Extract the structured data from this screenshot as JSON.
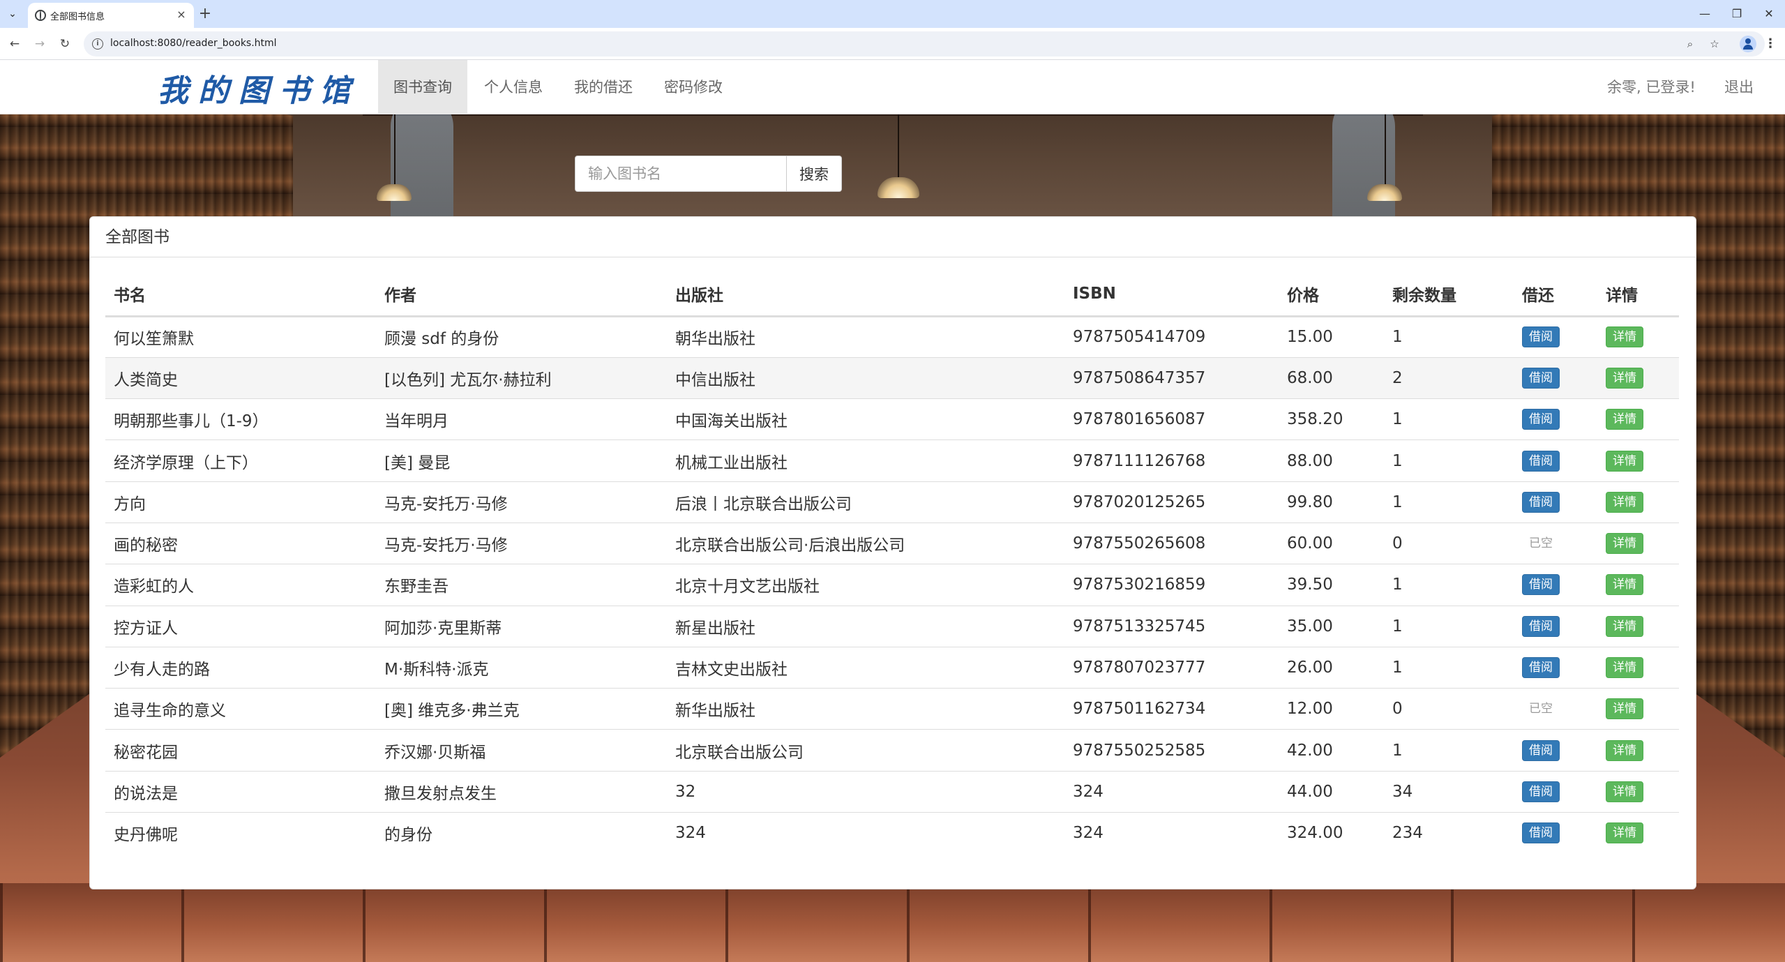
{
  "browser": {
    "tab_title": "全部图书信息",
    "url": "localhost:8080/reader_books.html",
    "tab_close": "×",
    "new_tab": "+",
    "minimize": "—",
    "restore": "❐",
    "close": "✕"
  },
  "navbar": {
    "brand": "我的图书馆",
    "items": [
      {
        "label": "图书查询",
        "active": true
      },
      {
        "label": "个人信息",
        "active": false
      },
      {
        "label": "我的借还",
        "active": false
      },
      {
        "label": "密码修改",
        "active": false
      }
    ],
    "user_status": "余零, 已登录!",
    "logout": "退出"
  },
  "search": {
    "placeholder": "输入图书名",
    "button": "搜索"
  },
  "panel": {
    "title": "全部图书",
    "columns": [
      "书名",
      "作者",
      "出版社",
      "ISBN",
      "价格",
      "剩余数量",
      "借还",
      "详情"
    ],
    "rows": [
      {
        "name": "何以笙箫默",
        "author": "顾漫 sdf 的身份",
        "publisher": "朝华出版社",
        "isbn": "9787505414709",
        "price": "15.00",
        "remaining": "1",
        "borrow": "借阅",
        "borrow_available": true,
        "detail": "详情"
      },
      {
        "name": "人类简史",
        "author": "[以色列] 尤瓦尔·赫拉利",
        "publisher": "中信出版社",
        "isbn": "9787508647357",
        "price": "68.00",
        "remaining": "2",
        "borrow": "借阅",
        "borrow_available": true,
        "detail": "详情"
      },
      {
        "name": "明朝那些事儿（1-9）",
        "author": "当年明月",
        "publisher": "中国海关出版社",
        "isbn": "9787801656087",
        "price": "358.20",
        "remaining": "1",
        "borrow": "借阅",
        "borrow_available": true,
        "detail": "详情"
      },
      {
        "name": "经济学原理（上下）",
        "author": "[美] 曼昆",
        "publisher": "机械工业出版社",
        "isbn": "9787111126768",
        "price": "88.00",
        "remaining": "1",
        "borrow": "借阅",
        "borrow_available": true,
        "detail": "详情"
      },
      {
        "name": "方向",
        "author": "马克-安托万·马修",
        "publisher": "后浪丨北京联合出版公司",
        "isbn": "9787020125265",
        "price": "99.80",
        "remaining": "1",
        "borrow": "借阅",
        "borrow_available": true,
        "detail": "详情"
      },
      {
        "name": "画的秘密",
        "author": "马克-安托万·马修",
        "publisher": "北京联合出版公司·后浪出版公司",
        "isbn": "9787550265608",
        "price": "60.00",
        "remaining": "0",
        "borrow": "已空",
        "borrow_available": false,
        "detail": "详情"
      },
      {
        "name": "造彩虹的人",
        "author": "东野圭吾",
        "publisher": "北京十月文艺出版社",
        "isbn": "9787530216859",
        "price": "39.50",
        "remaining": "1",
        "borrow": "借阅",
        "borrow_available": true,
        "detail": "详情"
      },
      {
        "name": "控方证人",
        "author": "阿加莎·克里斯蒂",
        "publisher": "新星出版社",
        "isbn": "9787513325745",
        "price": "35.00",
        "remaining": "1",
        "borrow": "借阅",
        "borrow_available": true,
        "detail": "详情"
      },
      {
        "name": "少有人走的路",
        "author": "M·斯科特·派克",
        "publisher": "吉林文史出版社",
        "isbn": "9787807023777",
        "price": "26.00",
        "remaining": "1",
        "borrow": "借阅",
        "borrow_available": true,
        "detail": "详情"
      },
      {
        "name": "追寻生命的意义",
        "author": "[奥] 维克多·弗兰克",
        "publisher": "新华出版社",
        "isbn": "9787501162734",
        "price": "12.00",
        "remaining": "0",
        "borrow": "已空",
        "borrow_available": false,
        "detail": "详情"
      },
      {
        "name": "秘密花园",
        "author": "乔汉娜·贝斯福",
        "publisher": "北京联合出版公司",
        "isbn": "9787550252585",
        "price": "42.00",
        "remaining": "1",
        "borrow": "借阅",
        "borrow_available": true,
        "detail": "详情"
      },
      {
        "name": "的说法是",
        "author": "撒旦发射点发生",
        "publisher": "32",
        "isbn": "324",
        "price": "44.00",
        "remaining": "34",
        "borrow": "借阅",
        "borrow_available": true,
        "detail": "详情"
      },
      {
        "name": "史丹佛呢",
        "author": "的身份",
        "publisher": "324",
        "isbn": "324",
        "price": "324.00",
        "remaining": "234",
        "borrow": "借阅",
        "borrow_available": true,
        "detail": "详情"
      }
    ]
  },
  "colors": {
    "brand": "#1f5aa6",
    "primary_button": "#337ab7",
    "success_button": "#5cb85c"
  }
}
